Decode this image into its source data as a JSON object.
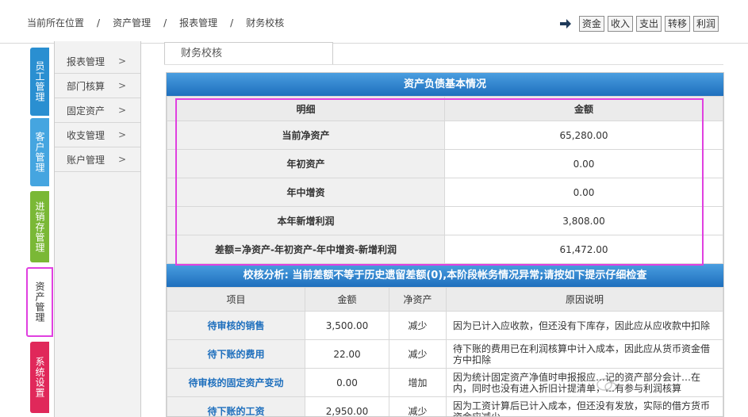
{
  "breadcrumb": {
    "items": [
      "当前所在位置",
      "资产管理",
      "报表管理",
      "财务校核"
    ],
    "separator": "/"
  },
  "quick_buttons": [
    "资金",
    "收入",
    "支出",
    "转移",
    "利润"
  ],
  "vtabs": [
    "员工管理",
    "客户管理",
    "进销存管理",
    "资产管理",
    "系统设置"
  ],
  "submenu": [
    {
      "label": "报表管理",
      "chev": ">"
    },
    {
      "label": "部门核算",
      "chev": ">"
    },
    {
      "label": "固定资产",
      "chev": ">"
    },
    {
      "label": "收支管理",
      "chev": ">"
    },
    {
      "label": "账户管理",
      "chev": ">"
    }
  ],
  "content_tab": "财务校核",
  "section1": {
    "title": "资产负债基本情况",
    "headers": [
      "明细",
      "金额"
    ],
    "rows": [
      {
        "label": "当前净资产",
        "value": "65,280.00"
      },
      {
        "label": "年初资产",
        "value": "0.00"
      },
      {
        "label": "年中增资",
        "value": "0.00"
      },
      {
        "label": "本年新增利润",
        "value": "3,808.00"
      },
      {
        "label": "差额=净资产-年初资产-年中增资-新增利润",
        "value": "61,472.00"
      }
    ]
  },
  "section2": {
    "title": "校核分析: 当前差额不等于历史遗留差额(0),本阶段帐务情况异常;请按如下提示仔细检查",
    "headers": [
      "项目",
      "金额",
      "净资产",
      "原因说明"
    ],
    "rows": [
      {
        "item": "待审核的销售",
        "amount": "3,500.00",
        "change": "减少",
        "reason": "因为已计入应收款，但还没有下库存，因此应从应收款中扣除"
      },
      {
        "item": "待下账的费用",
        "amount": "22.00",
        "change": "减少",
        "reason": "待下账的费用已在利润核算中计入成本，因此应从货币资金借方中扣除"
      },
      {
        "item": "待审核的固定资产变动",
        "amount": "0.00",
        "change": "增加",
        "reason": "因为统计固定资产净值时申报报应…记的资产部分会计…在内，同时也没有进入折旧计提清单，…有参与利润核算"
      },
      {
        "item": "待下账的工资",
        "amount": "2,950.00",
        "change": "减少",
        "reason": "因为工资计算后已计入成本，但还没有发放，实际的借方货币资金应减少"
      }
    ]
  },
  "colors": {
    "header_blue": "#1e6fbd",
    "highlight": "#e040e0",
    "tab_blue": "#2a8fd1",
    "tab_green": "#7ab836",
    "tab_red": "#e0285a"
  }
}
